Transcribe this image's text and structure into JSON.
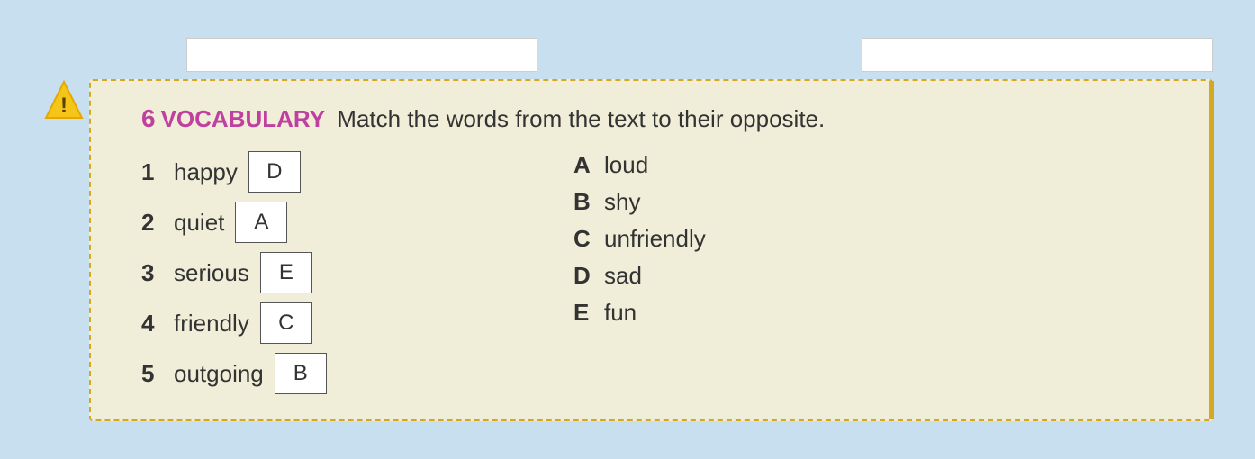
{
  "exercise": {
    "number": "6",
    "vocab_label": "VOCABULARY",
    "instruction": "Match the words from the text to their opposite.",
    "left_items": [
      {
        "number": "1",
        "word": "happy",
        "answer": "D"
      },
      {
        "number": "2",
        "word": "quiet",
        "answer": "A"
      },
      {
        "number": "3",
        "word": "serious",
        "answer": "E"
      },
      {
        "number": "4",
        "word": "friendly",
        "answer": "C"
      },
      {
        "number": "5",
        "word": "outgoing",
        "answer": "B"
      }
    ],
    "right_options": [
      {
        "letter": "A",
        "word": "loud"
      },
      {
        "letter": "B",
        "word": "shy"
      },
      {
        "letter": "C",
        "word": "unfriendly"
      },
      {
        "letter": "D",
        "word": "sad"
      },
      {
        "letter": "E",
        "word": "fun"
      }
    ]
  }
}
